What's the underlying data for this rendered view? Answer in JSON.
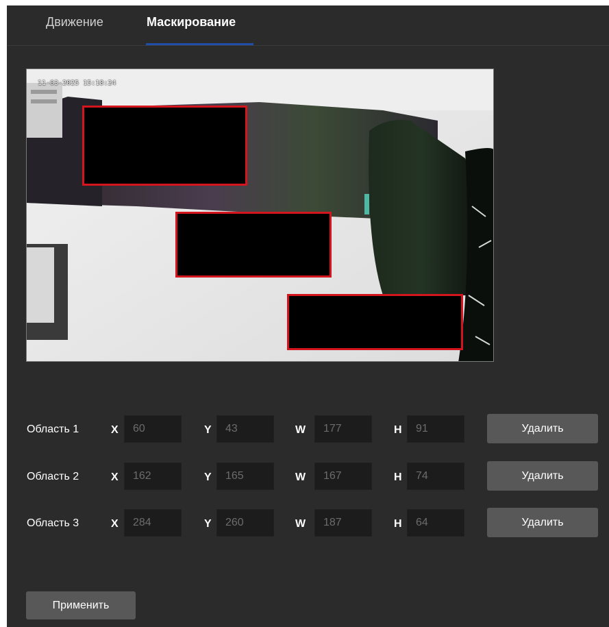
{
  "tabs": {
    "motion": "Движение",
    "mask": "Маскирование"
  },
  "preview": {
    "timestamp": "11-03-2025 15:18:24"
  },
  "areas": [
    {
      "label": "Область 1",
      "x": "60",
      "y": "43",
      "w": "177",
      "h": "91",
      "delete": "Удалить"
    },
    {
      "label": "Область 2",
      "x": "162",
      "y": "165",
      "w": "167",
      "h": "74",
      "delete": "Удалить"
    },
    {
      "label": "Область 3",
      "x": "284",
      "y": "260",
      "w": "187",
      "h": "64",
      "delete": "Удалить"
    }
  ],
  "axis_labels": {
    "x": "X",
    "y": "Y",
    "w": "W",
    "h": "H"
  },
  "apply_label": "Применить",
  "colors": {
    "panel_bg": "#2b2b2b",
    "mask_border": "#d4151d",
    "tab_accent": "#1f4fa8",
    "button_bg": "#585858"
  }
}
